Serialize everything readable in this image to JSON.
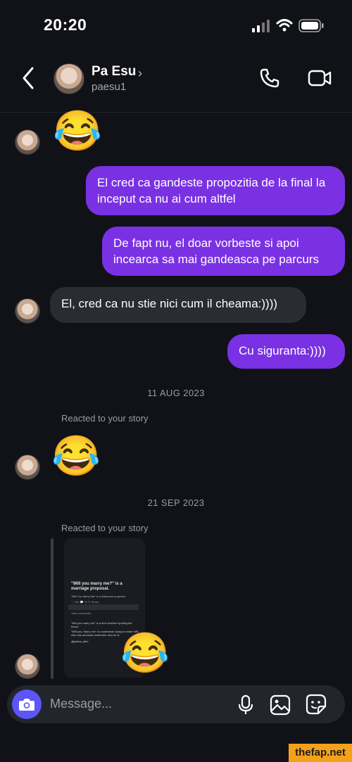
{
  "status_bar": {
    "time": "20:20"
  },
  "header": {
    "name": "Pa Esu",
    "chevron": "›",
    "username": "paesu1"
  },
  "messages": {
    "emoji_1": "😂",
    "out_1": "El cred ca gandeste propozitia de la final la inceput ca nu ai cum altfel",
    "out_2": "De fapt nu, el doar vorbeste si apoi incearca sa mai gandeasca pe parcurs",
    "in_1": "El, cred ca nu stie nici cum il cheama:))))",
    "out_3": "Cu siguranta:))))",
    "date_1": "11 AUG 2023",
    "reacted_1": "Reacted to your story",
    "emoji_2": "😂",
    "date_2": "21 SEP 2023",
    "reacted_2": "Reacted to your story",
    "emoji_3": "😂"
  },
  "story": {
    "title": "\"Will you marry me?\" is a marriage proposal.",
    "line1": "\"Will You Marry Me\" is a fearsome proposal.",
    "stats": "♡ 146   💬 16   ↻   Share",
    "comments": "View comments",
    "line2": "\"Will you marry me\" is a time traveler spoiling the future.",
    "line3": "\"Will you, Marry me\" is a salesman trying to make Will, who has amnesia remember who he is.",
    "handle": "@paesu_alex"
  },
  "composer": {
    "placeholder": "Message..."
  },
  "watermark": "thefap.net",
  "icons": [
    "signal-icon",
    "wifi-icon",
    "battery-icon",
    "back-icon",
    "phone-icon",
    "video-icon",
    "camera-icon",
    "mic-icon",
    "gallery-icon",
    "sticker-icon"
  ]
}
